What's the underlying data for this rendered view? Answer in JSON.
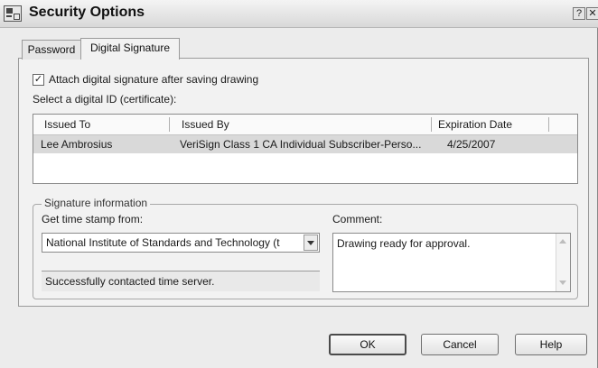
{
  "window": {
    "title": "Security Options",
    "help_glyph": "?",
    "close_glyph": "✕"
  },
  "tabs": [
    {
      "label": "Password"
    },
    {
      "label": "Digital Signature"
    }
  ],
  "attach_checkbox": {
    "checked": true,
    "check_glyph": "✓",
    "label": "Attach digital signature after saving drawing"
  },
  "certificates": {
    "label": "Select a digital ID (certificate):",
    "columns": [
      "Issued To",
      "Issued By",
      "Expiration Date"
    ],
    "rows": [
      {
        "issued_to": "Lee Ambrosius",
        "issued_by": "VeriSign Class 1 CA Individual Subscriber-Perso...",
        "expiration": "4/25/2007"
      }
    ]
  },
  "signature_info": {
    "legend": "Signature information",
    "timestamp_label": "Get time stamp from:",
    "timestamp_value": "National Institute of Standards and Technology (t",
    "status": "Successfully contacted time server.",
    "comment_label": "Comment:",
    "comment_value": "Drawing ready for approval."
  },
  "buttons": {
    "ok": "OK",
    "cancel": "Cancel",
    "help": "Help"
  }
}
